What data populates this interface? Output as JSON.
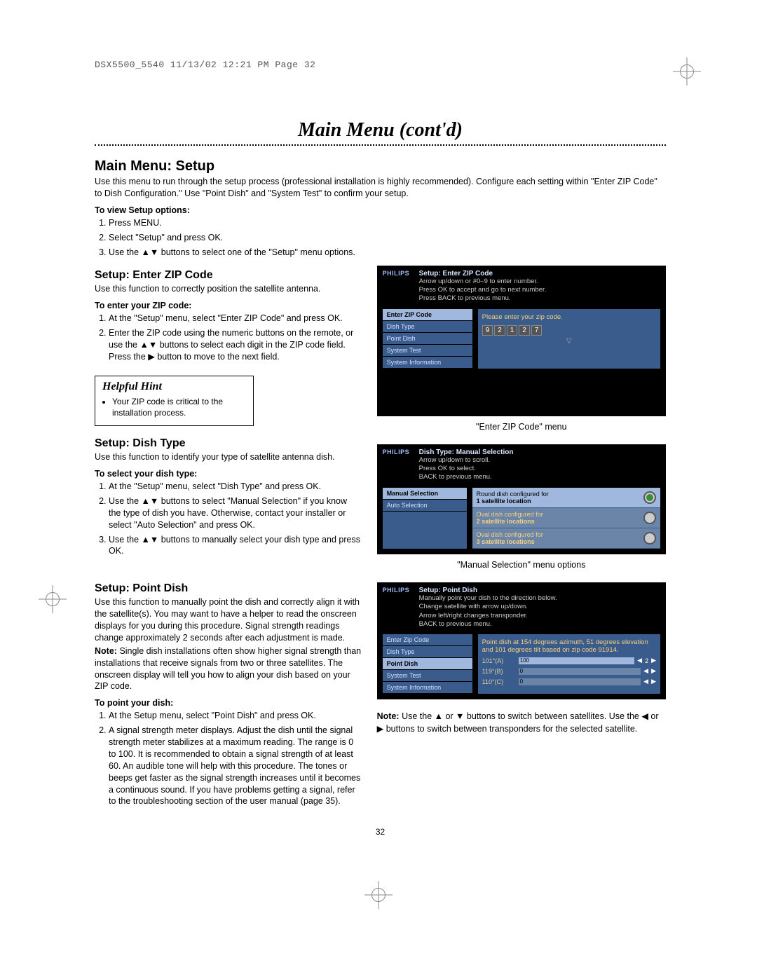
{
  "print_header": "DSX5500_5540  11/13/02  12:21 PM  Page 32",
  "main_title": "Main Menu (cont'd)",
  "h2": "Main Menu: Setup",
  "intro": "Use this menu to run through the setup process (professional installation is highly recommended). Configure each setting within \"Enter ZIP Code\" to Dish Configuration.\" Use \"Point Dish\" and \"System Test\" to confirm your setup.",
  "view_setup_head": "To view Setup options:",
  "view_setup": {
    "s1": "Press MENU.",
    "s2": "Select \"Setup\" and press OK.",
    "s3": "Use the ▲▼ buttons to select one of the \"Setup\" menu options."
  },
  "zip": {
    "heading": "Setup: Enter ZIP Code",
    "intro": "Use this function to correctly position the satellite antenna.",
    "subhead": "To enter your ZIP code:",
    "s1": "At the \"Setup\" menu, select \"Enter ZIP Code\" and press OK.",
    "s2": "Enter the ZIP code using the numeric buttons on the remote, or use the ▲▼ buttons to select each digit in the ZIP code field. Press the ▶ button to move to the next field."
  },
  "hint": {
    "title": "Helpful Hint",
    "text": "Your ZIP code is critical to the installation process."
  },
  "dish": {
    "heading": "Setup: Dish Type",
    "intro": "Use this function to identify your type of satellite antenna dish.",
    "subhead": "To select your dish type:",
    "s1": "At the \"Setup\" menu, select \"Dish Type\" and press OK.",
    "s2": "Use the ▲▼ buttons to select \"Manual Selection\" if you know the type of dish you have. Otherwise, contact your installer or select \"Auto Selection\" and press OK.",
    "s3": "Use the ▲▼ buttons to manually select your dish type and press OK."
  },
  "point": {
    "heading": "Setup: Point Dish",
    "intro": "Use this function to manually point the dish and correctly align it with the satellite(s). You may want to have a helper to read the onscreen displays for you during this procedure. Signal strength readings change approximately 2 seconds after each adjustment is made.",
    "note": "Single dish installations often show higher signal strength than installations that receive signals from two or three satellites. The onscreen display will tell you how to align your dish based on your ZIP code.",
    "subhead": "To point your dish:",
    "s1": "At the Setup menu, select \"Point Dish\" and press OK.",
    "s2": "A signal strength meter displays. Adjust the dish until the signal strength meter stabilizes at a maximum reading. The range is 0 to 100. It is recommended to obtain a signal strength of at least 60. An audible tone will help with this procedure. The tones or beeps get faster as the signal strength increases until it becomes a continuous sound. If you have problems getting a signal, refer to the troubleshooting section of the user manual (page 35)."
  },
  "captions": {
    "zip": "\"Enter ZIP Code\" menu",
    "dish": "\"Manual Selection\" menu options"
  },
  "ss_zip": {
    "title": "Setup: Enter ZIP Code",
    "instr1": "Arrow up/down or #0–9 to enter number.",
    "instr2": "Press OK to accept and go to next number.",
    "instr3": "Press BACK to previous menu.",
    "menu": [
      "Enter ZIP Code",
      "Dish Type",
      "Point Dish",
      "System Test",
      "System Information"
    ],
    "panel_text": "Please enter your zip code.",
    "digits": [
      "9",
      "2",
      "1",
      "2",
      "7"
    ]
  },
  "ss_dish": {
    "title": "Dish Type: Manual Selection",
    "instr1": "Arrow up/down to scroll.",
    "instr2": "Press OK to select.",
    "instr3": "BACK to previous menu.",
    "menu": [
      "Manual Selection",
      "Auto Selection"
    ],
    "opt1a": "Round dish configured for",
    "opt1b": "1 satellite location",
    "opt2a": "Oval dish configured for",
    "opt2b": "2 satellite locations",
    "opt3a": "Oval dish configured for",
    "opt3b": "3 satellite locations"
  },
  "ss_point": {
    "title": "Setup: Point Dish",
    "instr1": "Manually point your dish to the direction below.",
    "instr2": "Change satellite with arrow up/down.",
    "instr3": "Arrow left/right changes transponder.",
    "instr4": "BACK to previous menu.",
    "menu": [
      "Enter Zip Code",
      "Dish Type",
      "Point Dish",
      "System Test",
      "System Information"
    ],
    "panel_text": "Point dish at 154 degrees azimuth, 51 degrees elevation and 101 degrees tilt based on zip code 91914.",
    "rows": [
      {
        "label": "101°(A)",
        "val": "100",
        "num": "2"
      },
      {
        "label": "119°(B)",
        "val": "0",
        "num": ""
      },
      {
        "label": "110°(C)",
        "val": "0",
        "num": ""
      }
    ]
  },
  "bottom_note_pre": "Note:",
  "bottom_note": " Use the ▲ or ▼ buttons to switch between satellites. Use the ◀ or ▶ buttons to switch between transponders for the selected satellite.",
  "pagenum": "32",
  "philips": "PHILIPS"
}
